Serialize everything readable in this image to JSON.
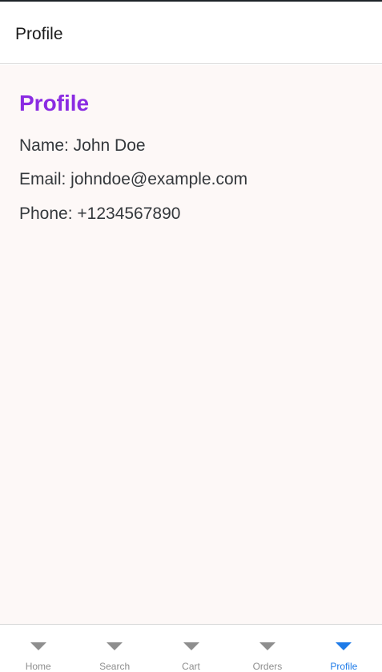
{
  "header": {
    "title": "Profile"
  },
  "main": {
    "heading": "Profile",
    "name_line": "Name: John Doe",
    "email_line": "Email: johndoe@example.com",
    "phone_line": "Phone: +1234567890"
  },
  "tabbar": {
    "active_index": 4,
    "colors": {
      "active": "#1e7be8",
      "inactive": "#8e8e8e"
    },
    "tabs": [
      {
        "label": "Home",
        "icon": "caret-down-icon"
      },
      {
        "label": "Search",
        "icon": "caret-down-icon"
      },
      {
        "label": "Cart",
        "icon": "caret-down-icon"
      },
      {
        "label": "Orders",
        "icon": "caret-down-icon"
      },
      {
        "label": "Profile",
        "icon": "caret-down-icon"
      }
    ]
  },
  "colors": {
    "heading": "#8a2be2",
    "content_background": "#fdf8f7",
    "text": "#34383c"
  }
}
